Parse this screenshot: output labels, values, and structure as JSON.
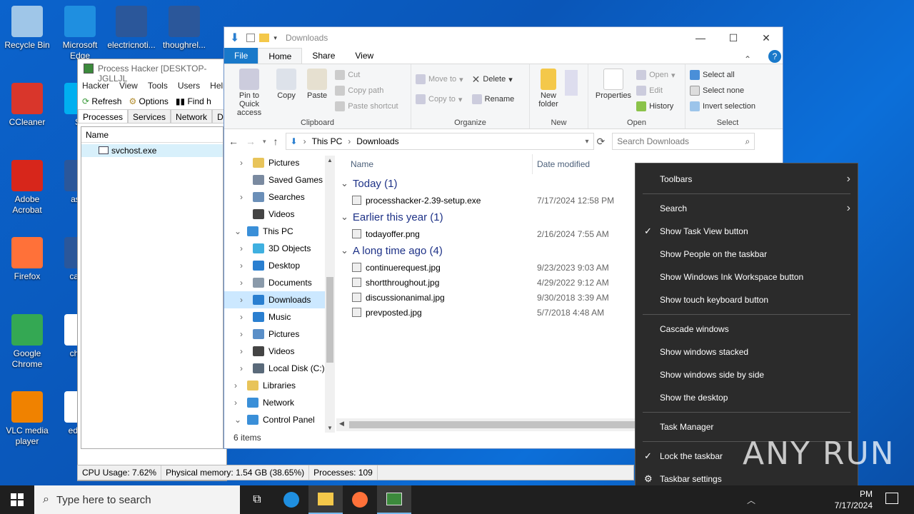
{
  "desktop": {
    "icons": [
      {
        "label": "Recycle Bin",
        "icon": "recycle-bin-icon",
        "color": "#9fc6e8"
      },
      {
        "label": "Microsoft Edge",
        "icon": "edge-icon",
        "color": "#1f8fe0"
      },
      {
        "label": "electricnoti...",
        "icon": "word-doc-icon",
        "color": "#2b579a"
      },
      {
        "label": "thoughrel...",
        "icon": "word-doc-icon",
        "color": "#2b579a"
      },
      {
        "label": "CCleaner",
        "icon": "ccleaner-icon",
        "color": "#d9362b"
      },
      {
        "label": "Sk",
        "icon": "skype-icon",
        "color": "#00aff0"
      },
      {
        "label": "Adobe Acrobat",
        "icon": "acrobat-icon",
        "color": "#d7261b"
      },
      {
        "label": "asoff",
        "icon": "word-doc-icon",
        "color": "#2b579a"
      },
      {
        "label": "Firefox",
        "icon": "firefox-icon",
        "color": "#ff7139"
      },
      {
        "label": "came",
        "icon": "word-doc-icon",
        "color": "#2b579a"
      },
      {
        "label": "Google Chrome",
        "icon": "chrome-icon",
        "color": "#34a853"
      },
      {
        "label": "christ",
        "icon": "doc-icon",
        "color": "#ffffff"
      },
      {
        "label": "VLC media player",
        "icon": "vlc-icon",
        "color": "#f08200"
      },
      {
        "label": "educa",
        "icon": "doc-icon",
        "color": "#ffffff"
      }
    ]
  },
  "process_hacker": {
    "title": "Process Hacker [DESKTOP-JGLLJL",
    "menu": [
      "Hacker",
      "View",
      "Tools",
      "Users",
      "Help"
    ],
    "toolbar": {
      "refresh": "Refresh",
      "options": "Options",
      "find": "Find h"
    },
    "tabs": [
      "Processes",
      "Services",
      "Network",
      "Disk"
    ],
    "column": "Name",
    "row": "svchost.exe",
    "status": {
      "cpu": "CPU Usage: 7.62%",
      "memory": "Physical memory: 1.54 GB (38.65%)",
      "processes": "Processes: 109"
    }
  },
  "explorer": {
    "title": "Downloads",
    "ribbon_tabs": [
      "File",
      "Home",
      "Share",
      "View"
    ],
    "clipboard": {
      "pin": "Pin to Quick access",
      "copy": "Copy",
      "paste": "Paste",
      "cut": "Cut",
      "copy_path": "Copy path",
      "paste_shortcut": "Paste shortcut",
      "label": "Clipboard"
    },
    "organize": {
      "move_to": "Move to",
      "copy_to": "Copy to",
      "delete": "Delete",
      "rename": "Rename",
      "label": "Organize"
    },
    "new": {
      "new_folder": "New folder",
      "label": "New"
    },
    "open": {
      "properties": "Properties",
      "open": "Open",
      "edit": "Edit",
      "history": "History",
      "label": "Open"
    },
    "select": {
      "select_all": "Select all",
      "select_none": "Select none",
      "invert": "Invert selection",
      "label": "Select"
    },
    "address": {
      "this_pc": "This PC",
      "folder": "Downloads",
      "search_placeholder": "Search Downloads"
    },
    "nav": [
      {
        "label": "Pictures",
        "indent": 2,
        "expander": ">",
        "color": "#e8c45a"
      },
      {
        "label": "Saved Games",
        "indent": 2,
        "expander": "",
        "color": "#7a8aa0"
      },
      {
        "label": "Searches",
        "indent": 2,
        "expander": ">",
        "color": "#6b8fb8"
      },
      {
        "label": "Videos",
        "indent": 2,
        "expander": "",
        "color": "#444444"
      },
      {
        "label": "This PC",
        "indent": 1,
        "expander": "v",
        "color": "#3a8fd8"
      },
      {
        "label": "3D Objects",
        "indent": 2,
        "expander": ">",
        "color": "#3fb0e0"
      },
      {
        "label": "Desktop",
        "indent": 2,
        "expander": ">",
        "color": "#2a7fd0"
      },
      {
        "label": "Documents",
        "indent": 2,
        "expander": ">",
        "color": "#8a9aaa"
      },
      {
        "label": "Downloads",
        "indent": 2,
        "expander": ">",
        "color": "#2a7fd0",
        "selected": true
      },
      {
        "label": "Music",
        "indent": 2,
        "expander": ">",
        "color": "#2a7fd0"
      },
      {
        "label": "Pictures",
        "indent": 2,
        "expander": ">",
        "color": "#5a8fc8"
      },
      {
        "label": "Videos",
        "indent": 2,
        "expander": ">",
        "color": "#444444"
      },
      {
        "label": "Local Disk (C:)",
        "indent": 2,
        "expander": ">",
        "color": "#5a6a7a"
      },
      {
        "label": "Libraries",
        "indent": 1,
        "expander": ">",
        "color": "#e8c45a"
      },
      {
        "label": "Network",
        "indent": 1,
        "expander": ">",
        "color": "#3a8fd8"
      },
      {
        "label": "Control Panel",
        "indent": 1,
        "expander": "v",
        "color": "#3a8fd8"
      }
    ],
    "columns": {
      "name": "Name",
      "date": "Date modified"
    },
    "groups": [
      {
        "title": "Today (1)",
        "files": [
          {
            "name": "processhacker-2.39-setup.exe",
            "date": "7/17/2024 12:58 PM"
          }
        ]
      },
      {
        "title": "Earlier this year (1)",
        "files": [
          {
            "name": "todayoffer.png",
            "date": "2/16/2024 7:55 AM"
          }
        ]
      },
      {
        "title": "A long time ago (4)",
        "files": [
          {
            "name": "continuerequest.jpg",
            "date": "9/23/2023 9:03 AM"
          },
          {
            "name": "shortthroughout.jpg",
            "date": "4/29/2022 9:12 AM"
          },
          {
            "name": "discussionanimal.jpg",
            "date": "9/30/2018 3:39 AM"
          },
          {
            "name": "prevposted.jpg",
            "date": "5/7/2018 4:48 AM"
          }
        ]
      }
    ],
    "status": "6 items"
  },
  "context_menu": {
    "items": [
      {
        "label": "Toolbars",
        "arrow": true
      },
      {
        "sep": true
      },
      {
        "label": "Search",
        "arrow": true
      },
      {
        "label": "Show Task View button",
        "check": true
      },
      {
        "label": "Show People on the taskbar"
      },
      {
        "label": "Show Windows Ink Workspace button"
      },
      {
        "label": "Show touch keyboard button"
      },
      {
        "sep": true
      },
      {
        "label": "Cascade windows"
      },
      {
        "label": "Show windows stacked"
      },
      {
        "label": "Show windows side by side"
      },
      {
        "label": "Show the desktop"
      },
      {
        "sep": true
      },
      {
        "label": "Task Manager"
      },
      {
        "sep": true
      },
      {
        "label": "Lock the taskbar",
        "check": true
      },
      {
        "label": "Taskbar settings",
        "gear": true
      }
    ]
  },
  "taskbar": {
    "search_placeholder": "Type here to search",
    "time": "PM",
    "date": "7/17/2024"
  },
  "watermark": "ANY RUN"
}
